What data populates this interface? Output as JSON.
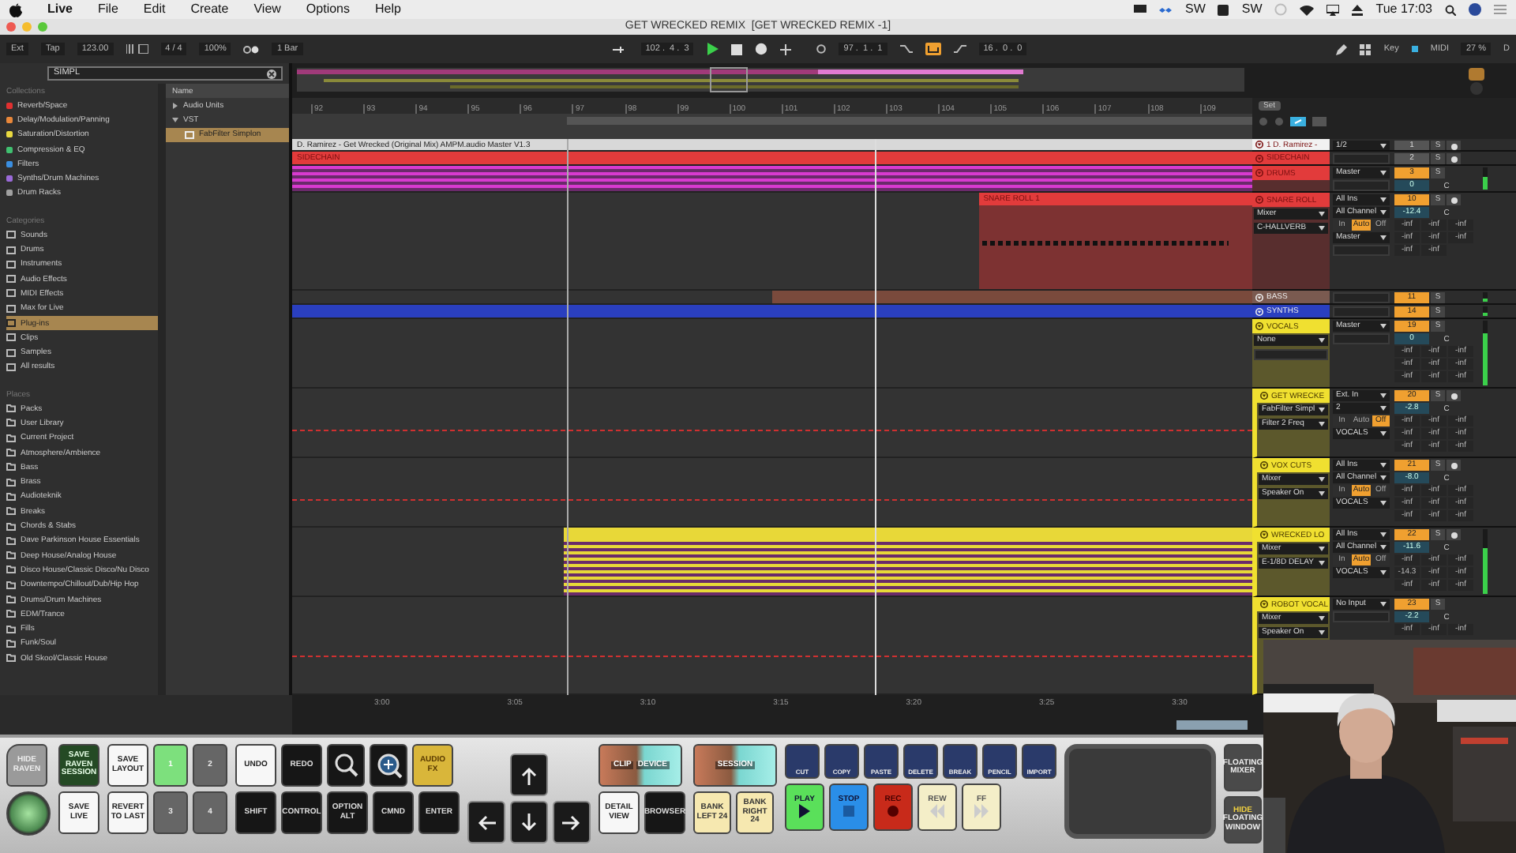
{
  "menu_bar": {
    "app": "Live",
    "items": [
      "File",
      "Edit",
      "Create",
      "View",
      "Options",
      "Help"
    ],
    "status_texts": [
      "SW",
      "SW"
    ],
    "clock": "Tue 17:03"
  },
  "window": {
    "title": "GET WRECKED REMIX  [GET WRECKED REMIX -1]"
  },
  "transport": {
    "ext": "Ext",
    "tap": "Tap",
    "tempo": "123.00",
    "signature": "4 / 4",
    "zoom": "100%",
    "quantize": "1 Bar",
    "position": "102 .  4 .  3",
    "loop_start": "97 .  1 .  1",
    "loop_on": true,
    "loop_length": "16 .  0 .  0",
    "key": "Key",
    "midi": "MIDI",
    "cpu": "27 %",
    "disk": "D"
  },
  "browser": {
    "search": "SIMPL",
    "collections_title": "Collections",
    "collections": [
      {
        "label": "Reverb/Space",
        "color": "#e03030"
      },
      {
        "label": "Delay/Modulation/Panning",
        "color": "#e8873a"
      },
      {
        "label": "Saturation/Distortion",
        "color": "#e8d840"
      },
      {
        "label": "Compression & EQ",
        "color": "#40c070"
      },
      {
        "label": "Filters",
        "color": "#3a8ee0"
      },
      {
        "label": "Synths/Drum Machines",
        "color": "#9a6ad8"
      },
      {
        "label": "Drum Racks",
        "color": "#a0a0a0"
      }
    ],
    "categories_title": "Categories",
    "categories": [
      {
        "label": "Sounds",
        "selected": false
      },
      {
        "label": "Drums",
        "selected": false
      },
      {
        "label": "Instruments",
        "selected": false
      },
      {
        "label": "Audio Effects",
        "selected": false
      },
      {
        "label": "MIDI Effects",
        "selected": false
      },
      {
        "label": "Max for Live",
        "selected": false
      },
      {
        "label": "Plug-ins",
        "selected": true
      },
      {
        "label": "Clips",
        "selected": false
      },
      {
        "label": "Samples",
        "selected": false
      },
      {
        "label": "All results",
        "selected": false
      }
    ],
    "places_title": "Places",
    "places": [
      "Packs",
      "User Library",
      "Current Project",
      "Atmosphere/Ambience",
      "Bass",
      "Brass",
      "Audioteknik",
      "Breaks",
      "Chords & Stabs",
      "Dave Parkinson House Essentials",
      "Deep House/Analog House",
      "Disco House/Classic Disco/Nu Disco",
      "Downtempo/Chillout/Dub/Hip Hop",
      "Drums/Drum Machines",
      "EDM/Trance",
      "Fills",
      "Funk/Soul",
      "Old Skool/Classic House"
    ],
    "name_header": "Name",
    "results": [
      {
        "label": "Audio Units",
        "expanded": false
      },
      {
        "label": "VST",
        "expanded": true,
        "children": [
          {
            "label": "FabFilter Simplon",
            "selected": true
          }
        ]
      }
    ]
  },
  "arrangement": {
    "ruler": [
      "92",
      "93",
      "94",
      "95",
      "96",
      "97",
      "98",
      "99",
      "100",
      "101",
      "102",
      "103",
      "104",
      "105",
      "106",
      "107",
      "108",
      "109"
    ],
    "time_ruler": [
      "3:00",
      "3:05",
      "3:10",
      "3:15",
      "3:20",
      "3:25",
      "3:30"
    ]
  },
  "mixer_header": {
    "set": "Set"
  },
  "tracks": [
    {
      "name": "1 D. Ramirez -",
      "color": "#f2f2f2",
      "kind": "collapsed",
      "clip": {
        "name": "D. Ramirez - Get Wrecked (Original Mix) AMPM.audio Master V1.3",
        "kind": "full",
        "color": "#d8d8d8"
      },
      "io": [
        {
          "kind": "dropdown",
          "text": "1/2"
        }
      ],
      "number": "1",
      "active": false,
      "solo": "S",
      "arm": true
    },
    {
      "name": "SIDECHAIN",
      "color": "#e23b3b",
      "kind": "collapsed",
      "clip": {
        "name": "SIDECHAIN",
        "kind": "full",
        "color": "#e23b3b"
      },
      "io": [
        {
          "kind": "empty"
        }
      ],
      "number": "2",
      "active": false,
      "solo": "S",
      "arm": true
    },
    {
      "name": "DRUMS",
      "color": "#e23b3b",
      "kind": "short",
      "clip": {
        "kind": "full",
        "color": "#d83ad0"
      },
      "io": [
        {
          "kind": "dropdown",
          "text": "Master"
        },
        {
          "kind": "empty"
        }
      ],
      "number": "3",
      "active": true,
      "solo": "S",
      "volume": "0",
      "pan": "C",
      "meter": {
        "level": 0.6
      }
    },
    {
      "name": "SNARE ROLL",
      "color": "#e23b3b",
      "kind": "tall",
      "clip": {
        "name": "SNARE ROLL 1",
        "kind": "late",
        "color": "#e23b3b"
      },
      "devices": [
        {
          "kind": "dropdown",
          "text": "Mixer"
        },
        {
          "kind": "dropdown",
          "text": "C-HALLVERB"
        }
      ],
      "io": [
        {
          "kind": "dropdown",
          "text": "All Ins"
        },
        {
          "kind": "dropdown",
          "text": "All Channel"
        },
        {
          "kind": "monitor",
          "options": [
            {
              "label": "In",
              "selected": false
            },
            {
              "label": "Auto",
              "selected": true
            },
            {
              "label": "Off",
              "selected": false
            }
          ]
        },
        {
          "kind": "dropdown",
          "text": "Master"
        },
        {
          "kind": "empty"
        }
      ],
      "number": "10",
      "active": true,
      "solo": "S",
      "arm": true,
      "volume": "-12.4",
      "pan": "C",
      "sends": [
        [
          "-inf",
          "-inf",
          "-inf"
        ],
        [
          "-inf",
          "-inf",
          "-inf"
        ],
        [
          "-inf",
          "-inf"
        ]
      ]
    },
    {
      "name": "BASS",
      "color": "#7a5a50",
      "kind": "collapsed",
      "clip": {
        "kind": "mid",
        "color": "#7a4a3c"
      },
      "io": [
        {
          "kind": "empty"
        }
      ],
      "number": "11",
      "active": true,
      "solo": "S",
      "meter": {
        "level": 0.3
      }
    },
    {
      "name": "SYNTHS",
      "color": "#2a3fbf",
      "kind": "collapsed",
      "clip": {
        "kind": "full",
        "color": "#2a3fbf"
      },
      "io": [
        {
          "kind": "empty"
        }
      ],
      "number": "14",
      "active": true,
      "solo": "S",
      "meter": {
        "level": 0.3
      }
    },
    {
      "name": "VOCALS",
      "color": "#f0e030",
      "kind": "expanded",
      "devices": [
        {
          "kind": "dropdown",
          "text": "None"
        },
        {
          "kind": "empty"
        }
      ],
      "io": [
        {
          "kind": "dropdown",
          "text": "Master"
        },
        {
          "kind": "empty"
        }
      ],
      "number": "19",
      "active": true,
      "solo": "S",
      "volume": "0",
      "pan": "C",
      "sends": [
        [
          "-inf",
          "-inf",
          "-inf"
        ],
        [
          "-inf",
          "-inf",
          "-inf"
        ],
        [
          "-inf",
          "-inf",
          "-inf"
        ]
      ],
      "meter": {
        "level": 0.8
      }
    },
    {
      "name": "GET WRECKE",
      "color": "#f0e030",
      "kind": "expanded",
      "in_group": true,
      "automation": true,
      "devices": [
        {
          "kind": "dropdown",
          "text": "FabFilter Simpl"
        },
        {
          "kind": "dropdown",
          "text": "Filter 2 Freq"
        }
      ],
      "io": [
        {
          "kind": "dropdown",
          "text": "Ext. In"
        },
        {
          "kind": "dropdown",
          "text": "2"
        },
        {
          "kind": "monitor",
          "options": [
            {
              "label": "In",
              "selected": false
            },
            {
              "label": "Auto",
              "selected": false
            },
            {
              "label": "Off",
              "selected": true
            }
          ]
        },
        {
          "kind": "dropdown",
          "text": "VOCALS"
        }
      ],
      "number": "20",
      "active": true,
      "solo": "S",
      "arm": true,
      "volume": "-2.8",
      "pan": "C",
      "sends": [
        [
          "-inf",
          "-inf",
          "-inf"
        ],
        [
          "-inf",
          "-inf",
          "-inf"
        ],
        [
          "-inf",
          "-inf",
          "-inf"
        ]
      ]
    },
    {
      "name": "VOX CUTS",
      "color": "#f0e030",
      "kind": "expanded",
      "in_group": true,
      "automation": true,
      "devices": [
        {
          "kind": "dropdown",
          "text": "Mixer"
        },
        {
          "kind": "dropdown",
          "text": "Speaker On"
        }
      ],
      "io": [
        {
          "kind": "dropdown",
          "text": "All Ins"
        },
        {
          "kind": "dropdown",
          "text": "All Channel"
        },
        {
          "kind": "monitor",
          "options": [
            {
              "label": "In",
              "selected": false
            },
            {
              "label": "Auto",
              "selected": true
            },
            {
              "label": "Off",
              "selected": false
            }
          ]
        },
        {
          "kind": "dropdown",
          "text": "VOCALS"
        }
      ],
      "number": "21",
      "active": true,
      "solo": "S",
      "arm": true,
      "volume": "-8.0",
      "pan": "C",
      "sends": [
        [
          "-inf",
          "-inf",
          "-inf"
        ],
        [
          "-inf",
          "-inf",
          "-inf"
        ],
        [
          "-inf",
          "-inf",
          "-inf"
        ]
      ]
    },
    {
      "name": "WRECKED LO",
      "color": "#f0e030",
      "kind": "expanded",
      "in_group": true,
      "clip": {
        "kind": "loop",
        "color": "#e8d838"
      },
      "devices": [
        {
          "kind": "dropdown",
          "text": "Mixer"
        },
        {
          "kind": "dropdown",
          "text": "E-1/8D DELAY"
        }
      ],
      "io": [
        {
          "kind": "dropdown",
          "text": "All Ins"
        },
        {
          "kind": "dropdown",
          "text": "All Channel"
        },
        {
          "kind": "monitor",
          "options": [
            {
              "label": "In",
              "selected": false
            },
            {
              "label": "Auto",
              "selected": true
            },
            {
              "label": "Off",
              "selected": false
            }
          ]
        },
        {
          "kind": "dropdown",
          "text": "VOCALS"
        }
      ],
      "number": "22",
      "active": true,
      "solo": "S",
      "arm": true,
      "volume": "-11.6",
      "pan": "C",
      "sends": [
        [
          "-inf",
          "-inf",
          "-inf"
        ],
        [
          "-14.3",
          "-inf",
          "-inf"
        ],
        [
          "-inf",
          "-inf",
          "-inf"
        ]
      ],
      "meter": {
        "level": 0.7
      }
    },
    {
      "name": "ROBOT VOCAL",
      "color": "#f0e030",
      "kind": "rest",
      "in_group": true,
      "automation": true,
      "devices": [
        {
          "kind": "dropdown",
          "text": "Mixer"
        },
        {
          "kind": "dropdown",
          "text": "Speaker On"
        }
      ],
      "io": [
        {
          "kind": "dropdown",
          "text": "No Input"
        },
        {
          "kind": "empty"
        }
      ],
      "number": "23",
      "active": true,
      "solo": "S",
      "volume": "-2.2",
      "pan": "C",
      "sends": [
        [
          "-inf",
          "-inf",
          "-inf"
        ]
      ]
    }
  ],
  "raven": {
    "groups": [
      {
        "rows": [
          [
            {
              "kind": "hide",
              "label": "HIDE RAVEN"
            }
          ],
          [
            {
              "kind": "knob"
            }
          ]
        ]
      },
      {
        "rows": [
          [
            {
              "kind": "green",
              "label": "SAVE RAVEN SESSION"
            }
          ],
          [
            {
              "kind": "white",
              "label": "SAVE LIVE"
            }
          ]
        ]
      },
      {
        "rows": [
          [
            {
              "kind": "white",
              "label": "SAVE LAYOUT"
            },
            {
              "kind": "number",
              "label": "1",
              "selected": true
            },
            {
              "kind": "number",
              "label": "2",
              "selected": false
            }
          ],
          [
            {
              "kind": "white",
              "label": "REVERT TO LAST"
            },
            {
              "kind": "number",
              "label": "3",
              "selected": false
            },
            {
              "kind": "number",
              "label": "4",
              "selected": false
            }
          ]
        ]
      },
      {
        "rows": [
          [
            {
              "kind": "white",
              "label": "UNDO"
            },
            {
              "kind": "black",
              "label": "REDO"
            },
            {
              "kind": "zoom-out"
            },
            {
              "kind": "zoom-in"
            },
            {
              "kind": "yellow",
              "label": "AUDIO FX"
            }
          ],
          [
            {
              "kind": "black",
              "label": "SHIFT"
            },
            {
              "kind": "black",
              "label": "CONTROL"
            },
            {
              "kind": "black",
              "label": "OPTION ALT"
            },
            {
              "kind": "black",
              "label": "CMND"
            },
            {
              "kind": "black",
              "label": "ENTER"
            }
          ]
        ]
      },
      {
        "rows": [
          [
            {
              "kind": "spacer"
            },
            {
              "kind": "arrow-up"
            },
            {
              "kind": "spacer"
            }
          ],
          [
            {
              "kind": "arrow-left"
            },
            {
              "kind": "arrow-down"
            },
            {
              "kind": "arrow-right"
            }
          ]
        ]
      },
      {
        "rows": [
          [
            {
              "label": "CLIP",
              "label2": "DEVICE"
            }
          ],
          [
            {
              "kind": "white",
              "label": "DETAIL VIEW"
            },
            {
              "kind": "black",
              "label": "BROWSER"
            }
          ]
        ]
      },
      {
        "rows": [
          [
            {
              "label2": "SESSION"
            }
          ],
          [
            {
              "kind": "cream",
              "label": "BANK LEFT 24"
            },
            {
              "kind": "cream",
              "label": "BANK RIGHT 24"
            }
          ]
        ]
      },
      {
        "rows": [
          [
            {
              "kind": "tool",
              "label": "CUT"
            },
            {
              "kind": "tool",
              "label": "COPY"
            },
            {
              "kind": "tool",
              "label": "PASTE"
            },
            {
              "kind": "tool",
              "label": "DELETE"
            },
            {
              "kind": "tool",
              "label": "BREAK"
            },
            {
              "kind": "tool",
              "label": "PENCIL"
            },
            {
              "kind": "tool",
              "label": "IMPORT"
            }
          ],
          [
            {
              "kind": "play",
              "label": "PLAY"
            },
            {
              "kind": "stop",
              "label": "STOP"
            },
            {
              "kind": "rec",
              "label": "REC"
            },
            {
              "kind": "rew",
              "label": "REW"
            },
            {
              "kind": "ff",
              "label": "FF"
            }
          ]
        ]
      },
      {
        "rows": [
          [
            {
              "kind": "pad"
            }
          ]
        ]
      },
      {
        "rows": [
          [
            {
              "kind": "metal",
              "label": "FLOATING MIXER"
            }
          ],
          [
            {
              "kind": "metal",
              "prefix": "HIDE",
              "label": "FLOATING WINDOW"
            }
          ]
        ]
      }
    ]
  }
}
